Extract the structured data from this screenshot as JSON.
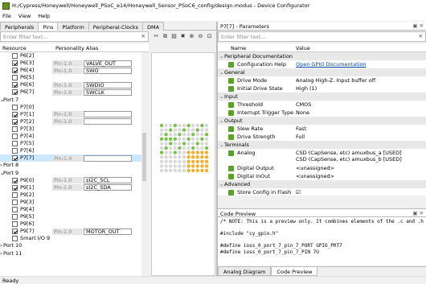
{
  "window": {
    "title": "H:/Cypress/Honeywell/Honeywell_PSoC_e14/Honeywell_Sensor_PSoC6_config/design.modus - Device Configurator"
  },
  "menu": [
    "File",
    "View",
    "Help"
  ],
  "left_tabs": [
    "Peripherals",
    "Pins",
    "Platform",
    "Peripheral-Clocks",
    "DMA"
  ],
  "left_active_tab": "Pins",
  "left_filter": {
    "placeholder": "Enter filter text...",
    "clear": "✕"
  },
  "left_columns": {
    "resource": "Resource",
    "personality": "Personality",
    "alias": "Alias"
  },
  "pin_rows": [
    {
      "type": "pin",
      "name": "P6[2]",
      "checked": false,
      "personality": "",
      "alias": ""
    },
    {
      "type": "pin",
      "name": "P6[3]",
      "checked": true,
      "personality": "Pin-1.0",
      "alias": "VALVE_OUT"
    },
    {
      "type": "pin",
      "name": "P6[4]",
      "checked": true,
      "personality": "Pin-1.0",
      "alias": "SWO"
    },
    {
      "type": "pin",
      "name": "P6[5]",
      "checked": false,
      "personality": "",
      "alias": ""
    },
    {
      "type": "pin",
      "name": "P6[6]",
      "checked": true,
      "personality": "Pin-1.0",
      "alias": "SWDIO"
    },
    {
      "type": "pin",
      "name": "P6[7]",
      "checked": true,
      "personality": "Pin-1.0",
      "alias": "SWCLK"
    },
    {
      "type": "port",
      "name": "Port 7",
      "expanded": true
    },
    {
      "type": "pin",
      "name": "P7[0]",
      "checked": false,
      "personality": "",
      "alias": ""
    },
    {
      "type": "pin",
      "name": "P7[1]",
      "checked": true,
      "personality": "Pin-1.0",
      "alias": ""
    },
    {
      "type": "pin",
      "name": "P7[2]",
      "checked": true,
      "personality": "Pin-1.0",
      "alias": ""
    },
    {
      "type": "pin",
      "name": "P7[3]",
      "checked": false,
      "personality": "",
      "alias": ""
    },
    {
      "type": "pin",
      "name": "P7[4]",
      "checked": false,
      "personality": "",
      "alias": ""
    },
    {
      "type": "pin",
      "name": "P7[5]",
      "checked": false,
      "personality": "",
      "alias": ""
    },
    {
      "type": "pin",
      "name": "P7[6]",
      "checked": false,
      "personality": "",
      "alias": ""
    },
    {
      "type": "pin",
      "name": "P7[7]",
      "checked": true,
      "personality": "Pin-1.0",
      "alias": "",
      "selected": true
    },
    {
      "type": "port",
      "name": "Port 8",
      "expanded": false
    },
    {
      "type": "port",
      "name": "Port 9",
      "expanded": true
    },
    {
      "type": "pin",
      "name": "P9[0]",
      "checked": true,
      "personality": "Pin-1.0",
      "alias": "sI2C_SCL"
    },
    {
      "type": "pin",
      "name": "P9[1]",
      "checked": true,
      "personality": "Pin-1.0",
      "alias": "sI2C_SDA"
    },
    {
      "type": "pin",
      "name": "P9[2]",
      "checked": false,
      "personality": "",
      "alias": ""
    },
    {
      "type": "pin",
      "name": "P9[3]",
      "checked": false,
      "personality": "",
      "alias": ""
    },
    {
      "type": "pin",
      "name": "P9[4]",
      "checked": false,
      "personality": "",
      "alias": ""
    },
    {
      "type": "pin",
      "name": "P9[5]",
      "checked": false,
      "personality": "",
      "alias": ""
    },
    {
      "type": "pin",
      "name": "P9[6]",
      "checked": false,
      "personality": "",
      "alias": ""
    },
    {
      "type": "pin",
      "name": "P9[7]",
      "checked": true,
      "personality": "Pin-1.0",
      "alias": "MOTOR_OUT"
    },
    {
      "type": "pin",
      "name": "Smart I/O 9",
      "checked": false,
      "personality": "",
      "alias": ""
    },
    {
      "type": "port",
      "name": "Port 10",
      "expanded": false
    },
    {
      "type": "port",
      "name": "Port 11",
      "expanded": false
    }
  ],
  "params_panel": {
    "title": "P7[7] - Parameters",
    "ctrls": "▣ ✕"
  },
  "params_filter": {
    "placeholder": "Enter filter text...",
    "clear": "✕"
  },
  "params_columns": {
    "name": "Name",
    "value": "Value"
  },
  "params": [
    {
      "cat": true,
      "name": "Peripheral Documentation"
    },
    {
      "name": "Configuration Help",
      "value": "Open GPIO Documentation",
      "link": true
    },
    {
      "cat": true,
      "name": "General"
    },
    {
      "name": "Drive Mode",
      "value": "Analog High-Z. Input buffer off"
    },
    {
      "name": "Initial Drive State",
      "value": "High (1)"
    },
    {
      "cat": true,
      "name": "Input"
    },
    {
      "name": "Threshold",
      "value": "CMOS"
    },
    {
      "name": "Interrupt Trigger Type",
      "value": "None"
    },
    {
      "cat": true,
      "name": "Output"
    },
    {
      "name": "Slew Rate",
      "value": "Fast"
    },
    {
      "name": "Drive Strength",
      "value": "Full"
    },
    {
      "cat": true,
      "name": "Terminals"
    },
    {
      "name": "Analog",
      "value": "CSD (CapSense, etc) amuxbus_a [USED]",
      "value2": "CSD (CapSense, etc) amuxbus_b [USED]",
      "tall": true
    },
    {
      "name": "Digital Output",
      "value": "<unassigned>"
    },
    {
      "name": "Digital InOut",
      "value": "<unassigned>"
    },
    {
      "cat": true,
      "name": "Advanced"
    },
    {
      "name": "Store Config in Flash",
      "value": "☑"
    }
  ],
  "code_panel": {
    "title": "Code Preview",
    "ctrls": "▣ ✕",
    "lines": [
      "/* NOTE: This is a preview only. It combines elements of the .c and .h",
      "",
      "#include \"cy_gpio.h\"",
      "",
      "#define ioss_0_port_7_pin_7_PORT GPIO_PRT7",
      "#define ioss_0_port_7_pin_7_PIN 7U"
    ]
  },
  "bottom_tabs": [
    "Analog Diagram",
    "Code Preview"
  ],
  "bottom_active": "Code Preview",
  "status": "Ready",
  "chip": {
    "used_color": "#79c04a",
    "special_color": "#f0b030",
    "free_color": "#d8d8d8"
  }
}
